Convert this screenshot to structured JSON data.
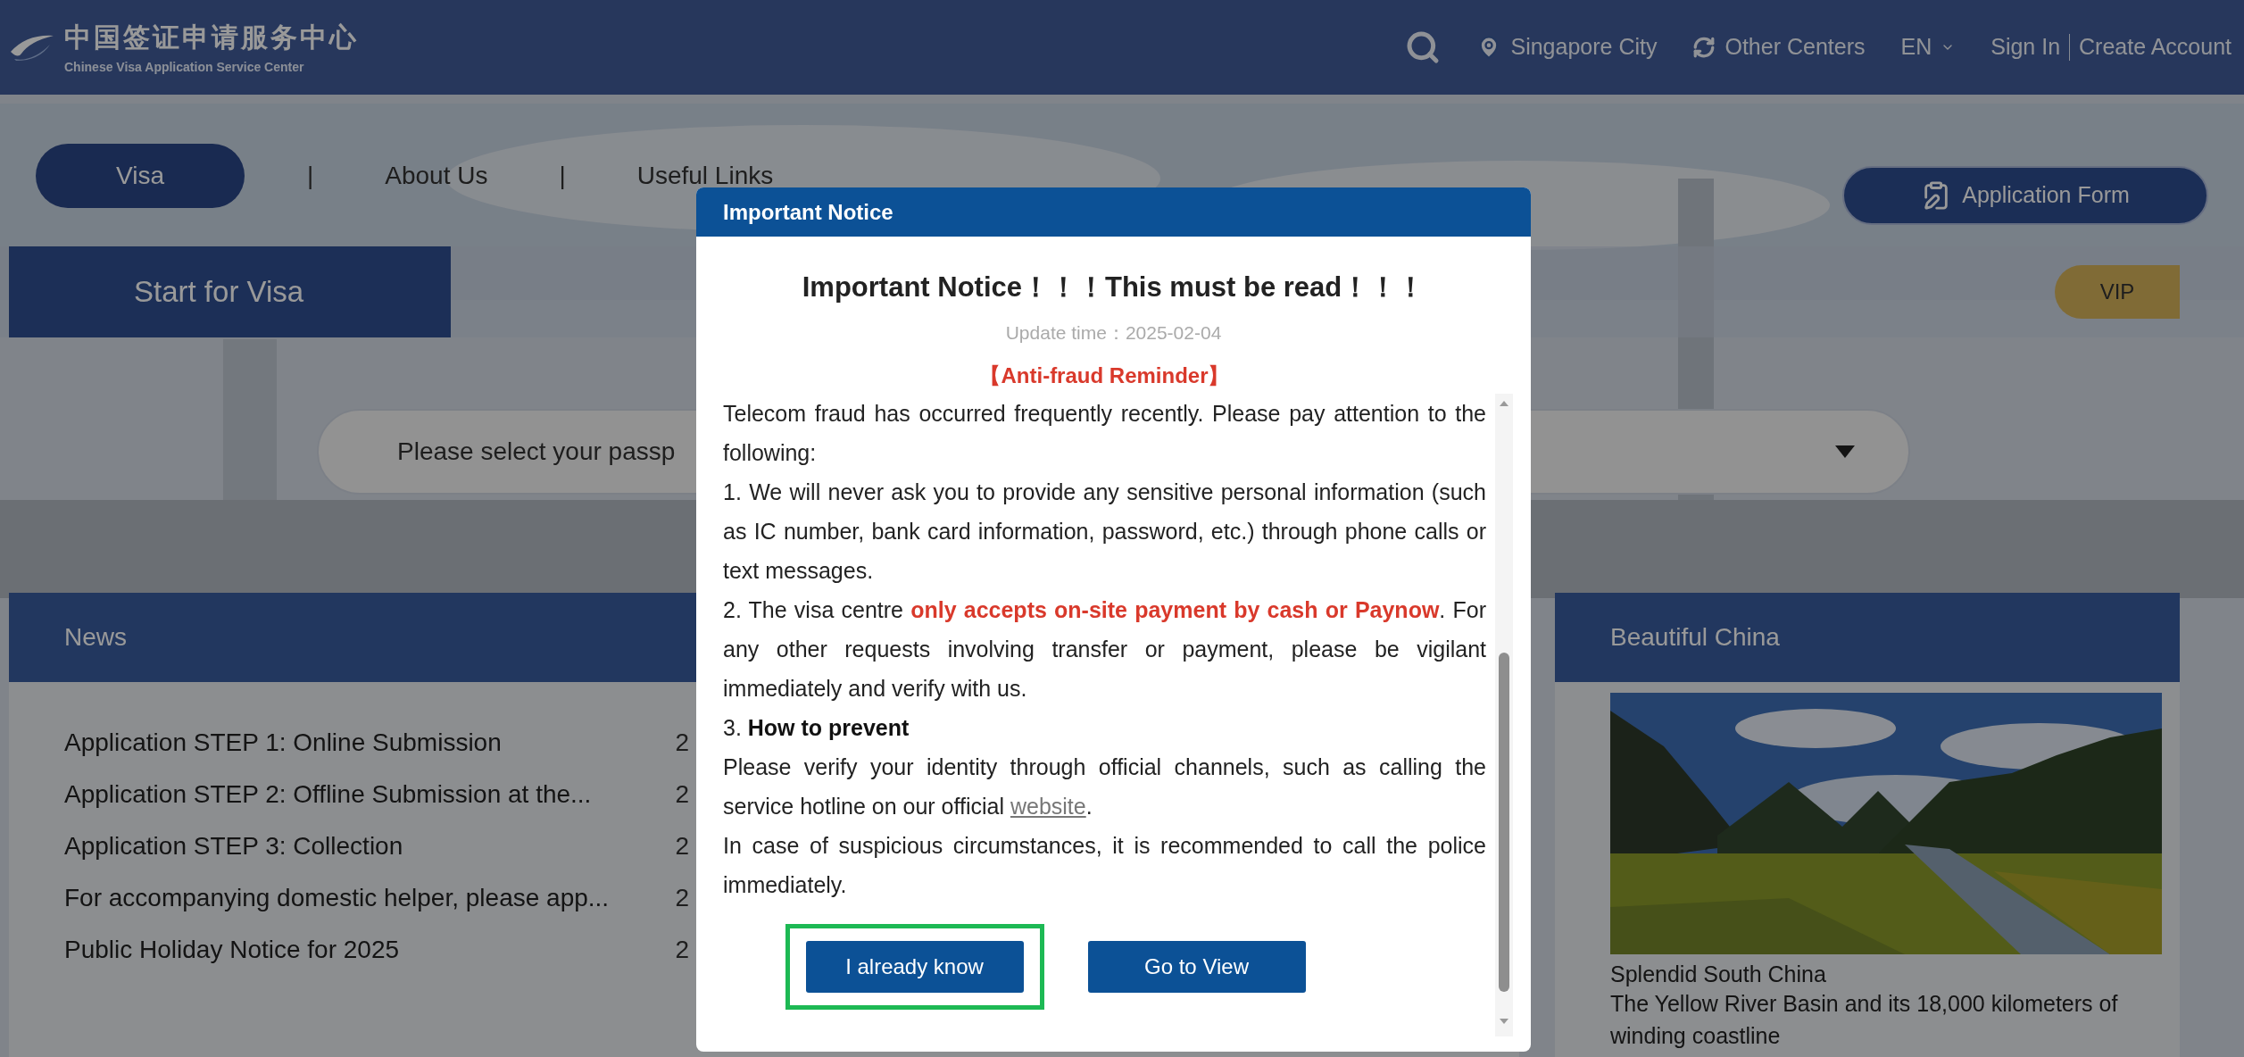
{
  "header": {
    "logo_title": "中国签证申请服务中心",
    "logo_subtitle": "Chinese Visa Application Service Center",
    "location": "Singapore City",
    "other_centers": "Other Centers",
    "language": "EN",
    "sign_in": "Sign In",
    "create_account": "Create Account"
  },
  "nav": {
    "items": [
      {
        "label": "Visa",
        "selected": true
      },
      {
        "label": "About Us",
        "selected": false
      },
      {
        "label": "Useful Links",
        "selected": false
      }
    ],
    "separator": "|",
    "application_form": "Application Form"
  },
  "visa_section": {
    "tab": "Start for Visa",
    "vip": "VIP",
    "passport_select": "Please select your passp"
  },
  "news": {
    "title": "News",
    "items": [
      {
        "title": "Application STEP 1: Online Submission",
        "date": "2"
      },
      {
        "title": "Application STEP 2: Offline Submission at the...",
        "date": "2"
      },
      {
        "title": "Application STEP 3: Collection",
        "date": "2"
      },
      {
        "title": "For accompanying domestic helper, please app...",
        "date": "2"
      },
      {
        "title": "Public Holiday Notice for 2025",
        "date": "2"
      }
    ]
  },
  "beautiful_china": {
    "title": "Beautiful China",
    "caption": "Splendid South China",
    "description": "The Yellow River Basin and its 18,000 kilometers of winding coastline"
  },
  "modal": {
    "title": "Important Notice",
    "heading": "Important Notice！！！This must be read！！！",
    "update_time": "Update time：2025-02-04",
    "section_title": "【Anti-fraud Reminder】",
    "paragraphs": [
      {
        "kind": "plain",
        "text": "Telecom fraud has occurred frequently recently. Please pay attention to the following:"
      },
      {
        "kind": "plain",
        "text": "1. We will never ask you to provide any sensitive personal information (such as IC number, bank card information, password, etc.) through phone calls or text messages."
      },
      {
        "kind": "warning",
        "text": "2. The visa centre **only accepts on-site payment by cash or Paynow**. For any other requests involving transfer or payment, please be vigilant immediately and verify with us."
      },
      {
        "kind": "plain",
        "text": "3. **How to prevent**"
      },
      {
        "kind": "plain",
        "text": "Please verify your identity through official channels, such as calling the service hotline on our official ",
        "link": "website",
        "after": "."
      },
      {
        "kind": "plain",
        "text": "In case of suspicious circumstances, it is recommended to call the police immediately."
      }
    ],
    "buttons": [
      {
        "label": "I already know",
        "highlighted": true
      },
      {
        "label": "Go to View",
        "highlighted": false
      }
    ]
  }
}
